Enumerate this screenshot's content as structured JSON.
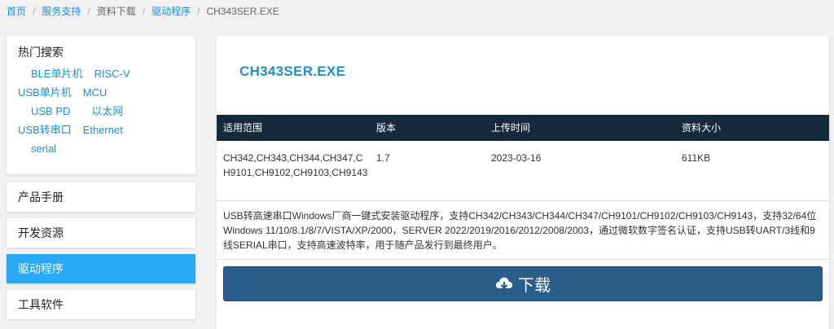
{
  "breadcrumb": {
    "items": [
      "首页",
      "服务支持",
      "资料下载",
      "驱动程序"
    ],
    "current": "CH343SER.EXE"
  },
  "sidebar": {
    "hot_title": "热门搜索",
    "hot_links": [
      "BLE单片机",
      "RISC-V",
      "USB单片机",
      "MCU",
      "USB PD",
      "以太网",
      "USB转串口",
      "Ethernet",
      "serial"
    ],
    "menu": [
      "产品手册",
      "开发资源",
      "驱动程序",
      "工具软件"
    ]
  },
  "file": {
    "title": "CH343SER.EXE",
    "headers": [
      "适用范围",
      "版本",
      "上传时间",
      "资料大小"
    ],
    "row": {
      "scope": "CH342,CH343,CH344,CH347,CH9101,CH9102,CH9103,CH9143",
      "version": "1.7",
      "upload_time": "2023-03-16",
      "size": "611KB"
    },
    "description": "USB转高速串口Windows厂商一键式安装驱动程序，支持CH342/CH343/CH344/CH347/CH9101/CH9102/CH9103/CH9143，支持32/64位 Windows 11/10/8.1/8/7/VISTA/XP/2000，SERVER 2022/2019/2016/2012/2008/2003，通过微软数字签名认证，支持USB转UART/3线和9线SERIAL串口，支持高速波特率，用于随产品发行到最终用户。",
    "download_label": "下载"
  },
  "colors": {
    "accent": "#1a8fd6",
    "active_menu": "#29a8f5",
    "table_header": "#17293b",
    "download_button": "#2c5e8c"
  },
  "icons": {
    "download": "cloud-download-icon"
  }
}
